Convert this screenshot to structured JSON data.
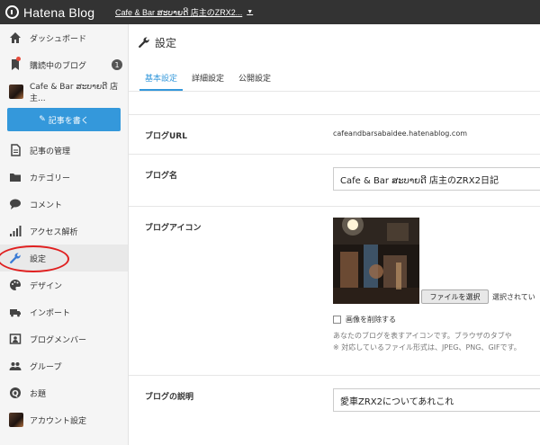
{
  "topbar": {
    "logo_text": "Hatena Blog",
    "blog_name": "Cafe & Bar ສະບາຍດີ 店主のZRX2..."
  },
  "sidebar": {
    "items": [
      {
        "label": "ダッシュボード",
        "icon": "home-icon"
      },
      {
        "label": "購読中のブログ",
        "icon": "bookmark-icon",
        "badge": "1"
      },
      {
        "label": "Cafe & Bar ສະບາຍດີ 店主...",
        "icon": "blog-thumbnail"
      },
      {
        "label": "記事を書く",
        "icon": "pen-icon"
      },
      {
        "label": "記事の管理",
        "icon": "document-icon"
      },
      {
        "label": "カテゴリー",
        "icon": "folder-icon"
      },
      {
        "label": "コメント",
        "icon": "comment-icon"
      },
      {
        "label": "アクセス解析",
        "icon": "bar-chart-icon"
      },
      {
        "label": "設定",
        "icon": "wrench-icon"
      },
      {
        "label": "デザイン",
        "icon": "palette-icon"
      },
      {
        "label": "インポート",
        "icon": "truck-icon"
      },
      {
        "label": "ブログメンバー",
        "icon": "member-icon"
      },
      {
        "label": "グループ",
        "icon": "group-icon"
      },
      {
        "label": "お題",
        "icon": "question-icon"
      },
      {
        "label": "アカウント設定",
        "icon": "avatar"
      }
    ],
    "highlight_color": "#e02020"
  },
  "main": {
    "title": "設定",
    "tabs": [
      {
        "label": "基本設定"
      },
      {
        "label": "詳細設定"
      },
      {
        "label": "公開設定"
      }
    ],
    "fields": {
      "url_label": "ブログURL",
      "url_value": "cafeandbarsabaidee.hatenablog.com",
      "name_label": "ブログ名",
      "name_value": "Cafe & Bar ສະບາຍດີ 店主のZRX2日記",
      "icon_label": "ブログアイコン",
      "file_button": "ファイルを選択",
      "file_status": "選択されてい",
      "delete_label": "画像を削除する",
      "help_1": "あなたのブログを表すアイコンです。ブラウザのタブや",
      "help_2": "※ 対応しているファイル形式は、JPEG、PNG、GIFです。",
      "desc_label": "ブログの説明",
      "desc_value": "愛車ZRX2についてあれこれ"
    }
  },
  "colors": {
    "accent": "#3498db",
    "topbar": "#333333",
    "sidebar_bg": "#f5f5f5"
  }
}
